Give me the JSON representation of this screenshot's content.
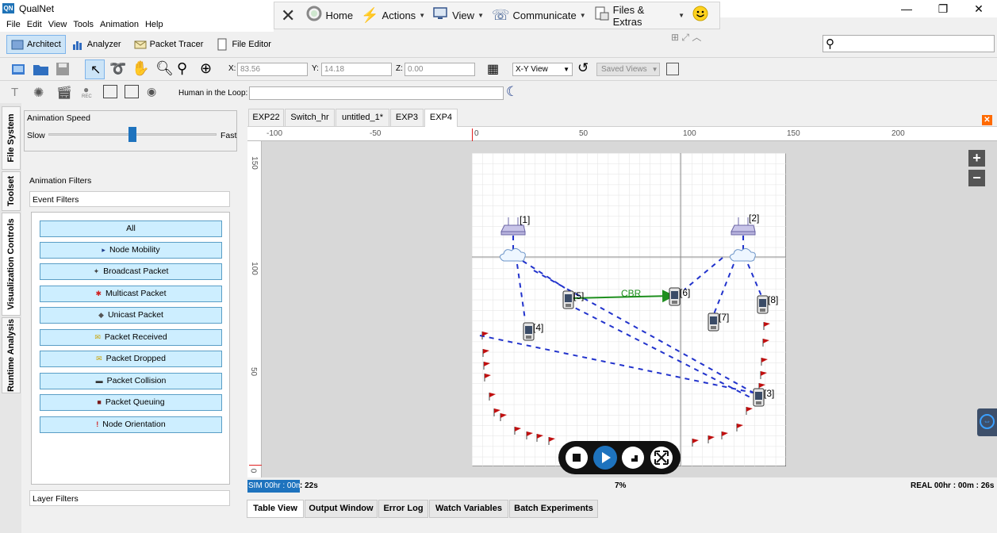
{
  "app": {
    "title": "QualNet",
    "icon_text": "QN"
  },
  "window_controls": {
    "minimize": "—",
    "maximize": "❐",
    "close": "✕"
  },
  "menu": [
    "File",
    "Edit",
    "View",
    "Tools",
    "Animation",
    "Help"
  ],
  "quickbar": {
    "home": "Home",
    "actions": "Actions",
    "view": "View",
    "communicate": "Communicate",
    "files_extras": "Files & Extras"
  },
  "modes": {
    "architect": "Architect",
    "analyzer": "Analyzer",
    "packet_tracer": "Packet Tracer",
    "file_editor": "File Editor"
  },
  "coords": {
    "x_label": "X:",
    "x_value": "83.56",
    "y_label": "Y:",
    "y_value": "14.18",
    "z_label": "Z:",
    "z_value": "0.00",
    "view_select": "X-Y View",
    "saved_views": "Saved Views"
  },
  "hitl": {
    "label": "Human in the Loop:",
    "value": ""
  },
  "side_tabs": [
    "File System",
    "Toolset",
    "Visualization Controls",
    "Runtime Analysis"
  ],
  "panel": {
    "speed_title": "Animation Speed",
    "slow": "Slow",
    "fast": "Fast",
    "speed_level": 0.5,
    "filters_title": "Animation Filters",
    "event_filters": "Event Filters",
    "layer_filters": "Layer Filters"
  },
  "filters": [
    {
      "label": "All",
      "icon": "",
      "icon_name": "none"
    },
    {
      "label": "Node Mobility",
      "icon": "▸",
      "icon_name": "mobility-icon"
    },
    {
      "label": "Broadcast Packet",
      "icon": "✦",
      "icon_name": "broadcast-icon"
    },
    {
      "label": "Multicast Packet",
      "icon": "✱",
      "icon_name": "multicast-icon"
    },
    {
      "label": "Unicast Packet",
      "icon": "◆",
      "icon_name": "unicast-icon"
    },
    {
      "label": "Packet Received",
      "icon": "✉",
      "icon_name": "received-icon"
    },
    {
      "label": "Packet Dropped",
      "icon": "✉",
      "icon_name": "dropped-icon"
    },
    {
      "label": "Packet Collision",
      "icon": "▬",
      "icon_name": "collision-icon"
    },
    {
      "label": "Packet Queuing",
      "icon": "■",
      "icon_name": "queuing-icon"
    },
    {
      "label": "Node Orientation",
      "icon": "!",
      "icon_name": "orientation-icon"
    }
  ],
  "doc_tabs": [
    "EXP22",
    "Switch_hr",
    "untitled_1*",
    "EXP3",
    "EXP4"
  ],
  "active_doc_tab": "EXP4",
  "ruler": {
    "h": [
      "-100",
      "-50",
      "0",
      "50",
      "100",
      "150",
      "200"
    ],
    "v": [
      "150",
      "100",
      "50",
      "0"
    ]
  },
  "canvas": {
    "cbr_label": "CBR",
    "nodes": [
      {
        "id": "[1]",
        "type": "access-point"
      },
      {
        "id": "[2]",
        "type": "access-point"
      },
      {
        "id": "[3]",
        "type": "mobile"
      },
      {
        "id": "[4]",
        "type": "mobile"
      },
      {
        "id": "[5]",
        "type": "mobile"
      },
      {
        "id": "[6]",
        "type": "mobile"
      },
      {
        "id": "[7]",
        "type": "mobile"
      },
      {
        "id": "[8]",
        "type": "mobile"
      }
    ]
  },
  "status": {
    "sim_prefix": "SIM 00hr : 00m",
    "sim_suffix": ": 22s",
    "percent": "7%",
    "real": "REAL 00hr : 00m : 26s"
  },
  "bottom_tabs": [
    "Table View",
    "Output Window",
    "Error Log",
    "Watch Variables",
    "Batch Experiments"
  ],
  "colors": {
    "accent": "#1e73be",
    "filter_bg": "#cdeeff",
    "cbr": "#1e8f1e",
    "link": "#2233cc",
    "flag": "#c01010"
  }
}
